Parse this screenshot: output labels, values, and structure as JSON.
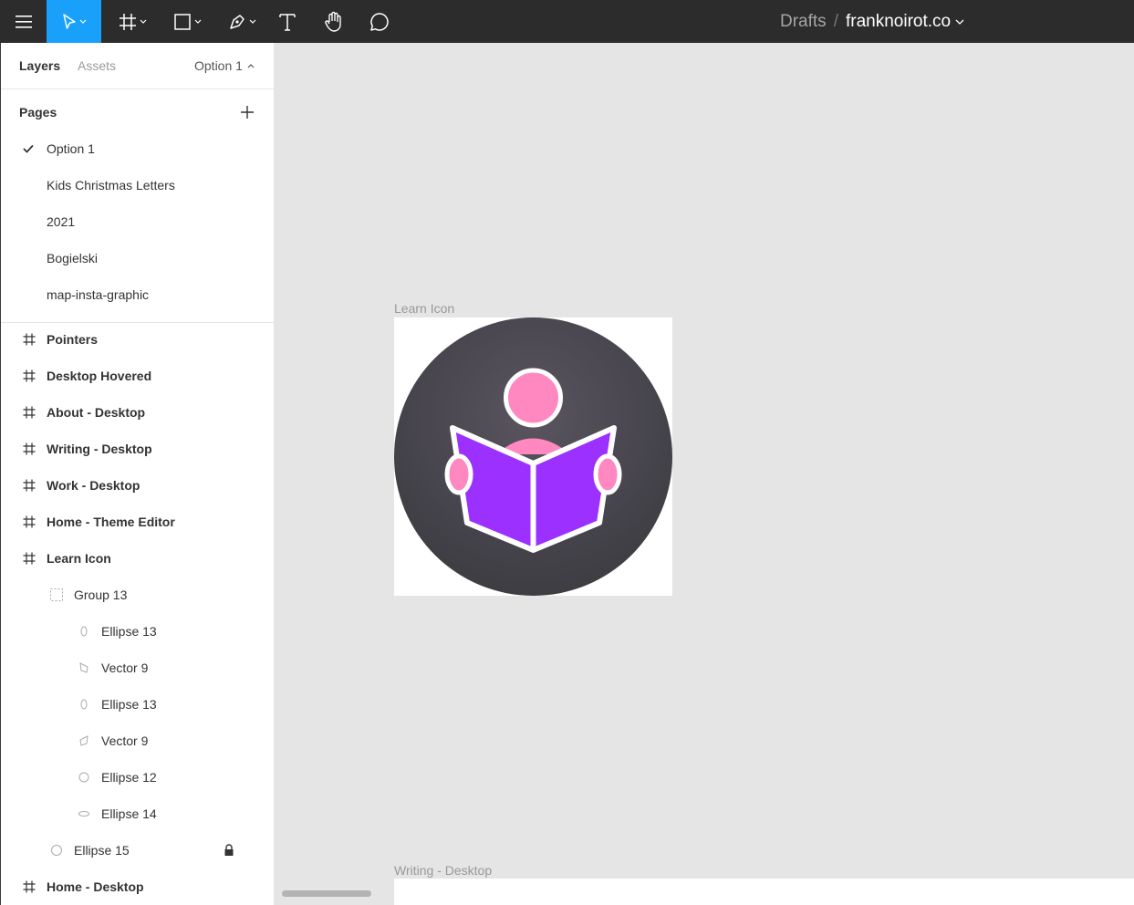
{
  "toolbar": {
    "menu_icon": "hamburger-menu-icon",
    "tools": [
      "move-tool",
      "frame-tool",
      "shape-tool",
      "pen-tool",
      "text-tool",
      "hand-tool",
      "comment-tool"
    ],
    "breadcrumb_drafts": "Drafts",
    "breadcrumb_separator": "/",
    "file_name": "franknoirot.co",
    "accent_color": "#18a0fb"
  },
  "panel": {
    "tab_layers": "Layers",
    "tab_assets": "Assets",
    "current_page": "Option 1",
    "pages_heading": "Pages",
    "pages": [
      {
        "label": "Option 1",
        "selected": true
      },
      {
        "label": "Kids Christmas Letters",
        "selected": false
      },
      {
        "label": "2021",
        "selected": false
      },
      {
        "label": "Bogielski",
        "selected": false
      },
      {
        "label": "map-insta-graphic",
        "selected": false
      }
    ],
    "layers": [
      {
        "label": "Pointers",
        "type": "frame"
      },
      {
        "label": "Desktop Hovered",
        "type": "frame"
      },
      {
        "label": "About - Desktop",
        "type": "frame"
      },
      {
        "label": "Writing - Desktop",
        "type": "frame"
      },
      {
        "label": "Work - Desktop",
        "type": "frame"
      },
      {
        "label": "Home - Theme Editor",
        "type": "frame"
      },
      {
        "label": "Learn Icon",
        "type": "frame"
      },
      {
        "label": "Group 13",
        "type": "group"
      },
      {
        "label": "Ellipse 13",
        "type": "ellipse"
      },
      {
        "label": "Vector 9",
        "type": "vector"
      },
      {
        "label": "Ellipse 13",
        "type": "ellipse"
      },
      {
        "label": "Vector 9",
        "type": "vector"
      },
      {
        "label": "Ellipse 12",
        "type": "ellipse"
      },
      {
        "label": "Ellipse 14",
        "type": "ellipse"
      },
      {
        "label": "Ellipse 15",
        "type": "ellipse",
        "locked": true
      },
      {
        "label": "Home - Desktop",
        "type": "frame"
      }
    ]
  },
  "canvas": {
    "background": "#e5e5e5",
    "frame_learn_icon": "Learn Icon",
    "frame_writing_desktop": "Writing - Desktop",
    "icon_colors": {
      "circle": "#4a4a52",
      "book": "#9b30ff",
      "person": "#ff88c0"
    }
  }
}
